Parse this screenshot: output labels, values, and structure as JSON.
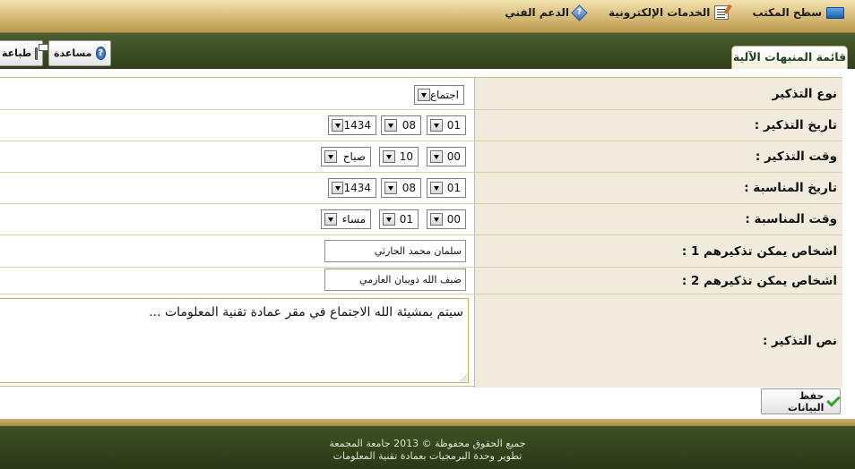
{
  "topnav": {
    "desktop_label": "سطح المكتب",
    "eservices_label": "الخدمات الإلكترونية",
    "support_label": "الدعم الفني"
  },
  "toolbar": {
    "tab_label": "قائمة المنبهات الآلية",
    "help_label": "مساعدة",
    "print_label": "طباعة"
  },
  "form": {
    "reminder_type": {
      "label": "نوع التذكير",
      "value": "اجتماع"
    },
    "reminder_date": {
      "label": "تاريخ التذكير :",
      "day": "01",
      "month": "08",
      "year": "1434"
    },
    "reminder_time": {
      "label": "وقت التذكير :",
      "hour": "00",
      "minute": "10",
      "period": "صباح"
    },
    "occasion_date": {
      "label": "تاريخ المناسبة :",
      "day": "01",
      "month": "08",
      "year": "1434"
    },
    "occasion_time": {
      "label": "وقت المناسبة :",
      "hour": "00",
      "minute": "01",
      "period": "مساء"
    },
    "persons1": {
      "label": "اشخاص يمكن تذكيرهم 1 :",
      "value": "سلمان محمد الحارثي"
    },
    "persons2": {
      "label": "اشخاص يمكن تذكيرهم 2 :",
      "value": "ضيف الله ذويبان العازمي"
    },
    "text": {
      "label": "نص التذكير :",
      "value": "سيتم بمشيئة الله الاجتماع في مقر عمادة تقنية المعلومات ..."
    },
    "save_label": "حفظ البيانات"
  },
  "footer": {
    "line1": "جميع الحقوق محفوظة © 2013 جامعة المجمعة",
    "line2": "تطوير وحدة البرمجيات بعمادة تقنية المعلومات"
  }
}
